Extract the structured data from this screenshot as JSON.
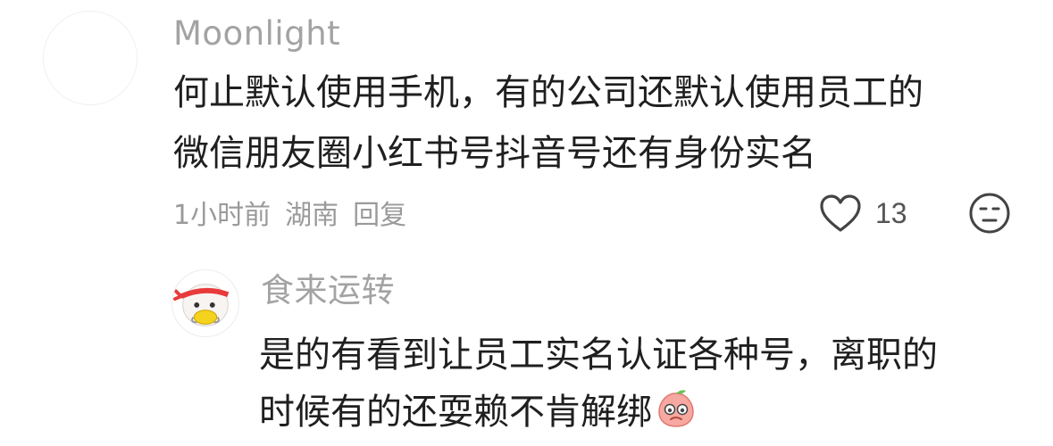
{
  "comments": [
    {
      "username": "Moonlight",
      "text_lines": [
        "何止默认使用手机，有的公司还默认使用员工的",
        "微信朋友圈小红书号抖音号还有身份实名"
      ],
      "time": "1小时前",
      "location": "湖南",
      "reply_label": "回复",
      "like_count": "13",
      "icons": {
        "like": "heart-outline-icon",
        "dislike": "unamused-face-icon"
      }
    },
    {
      "username": "食来运转",
      "text_lines": [
        "是的有看到让员工实名认证各种号，离职的",
        "时候有的还耍赖不肯解绑"
      ],
      "inline_emoji": "peach-face-emoji",
      "avatar": "cartoon-girl-headband-avatar"
    }
  ]
}
